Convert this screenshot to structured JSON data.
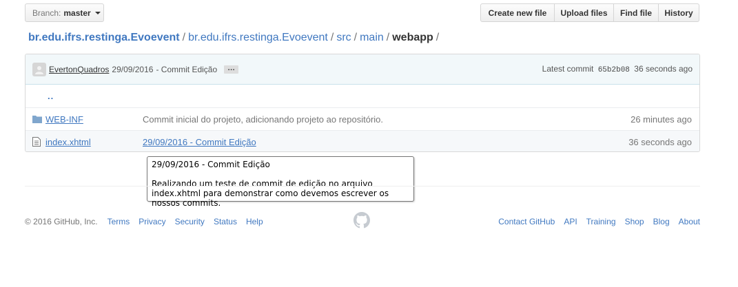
{
  "branch": {
    "label": "Branch:",
    "name": "master"
  },
  "actions": [
    "Create new file",
    "Upload files",
    "Find file",
    "History"
  ],
  "breadcrumb": {
    "root": "br.edu.ifrs.restinga.Evoevent",
    "parts": [
      "br.edu.ifrs.restinga.Evoevent",
      "src",
      "main"
    ],
    "current": "webapp",
    "separator": "/"
  },
  "commit": {
    "author": "EvertonQuadros",
    "date": "29/09/2016",
    "sep": "-",
    "message": "Commit Edição",
    "ellipsis": "…",
    "latest_label": "Latest commit",
    "sha": "65b2b08",
    "age": "36 seconds ago"
  },
  "files": [
    {
      "icon": "up-icon",
      "name": "..",
      "message": "",
      "age": ""
    },
    {
      "icon": "folder-icon",
      "name": "WEB-INF",
      "message": "Commit inicial do projeto, adicionando projeto ao repositório.",
      "age": "26 minutes ago"
    },
    {
      "icon": "file-icon",
      "name": "index.xhtml",
      "message": "29/09/2016 - Commit Edição",
      "age": "36 seconds ago"
    }
  ],
  "tooltip": {
    "title": "29/09/2016 - Commit Edição",
    "body": "Realizando um teste de commit de edição no arquivo index.xhtml para demonstrar como devemos escrever os nossos commits."
  },
  "footer": {
    "copyright": "© 2016 GitHub, Inc.",
    "left_links": [
      "Terms",
      "Privacy",
      "Security",
      "Status",
      "Help"
    ],
    "right_links": [
      "Contact GitHub",
      "API",
      "Training",
      "Shop",
      "Blog",
      "About"
    ],
    "logo_icon": "github-mark-icon"
  },
  "colors": {
    "link": "#4078c0",
    "tease_bg": "#f2f8fa",
    "muted": "#767676"
  }
}
